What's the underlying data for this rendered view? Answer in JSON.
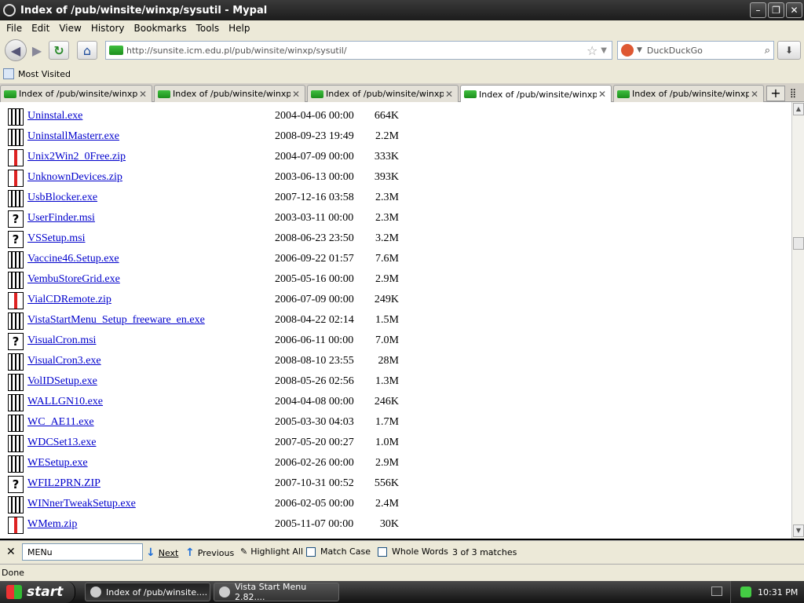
{
  "window": {
    "title": "Index of /pub/winsite/winxp/sysutil - Mypal"
  },
  "menu": [
    "File",
    "Edit",
    "View",
    "History",
    "Bookmarks",
    "Tools",
    "Help"
  ],
  "nav": {
    "url": "http://sunsite.icm.edu.pl/pub/winsite/winxp/sysutil/",
    "search_placeholder": "DuckDuckGo"
  },
  "bookmarks": {
    "most_visited": "Most Visited"
  },
  "tabs": [
    {
      "label": "Index of /pub/winsite/winxp",
      "active": false
    },
    {
      "label": "Index of /pub/winsite/winxp/...",
      "active": false
    },
    {
      "label": "Index of /pub/winsite/winxp/...",
      "active": false
    },
    {
      "label": "Index of /pub/winsite/winxp/...",
      "active": true
    },
    {
      "label": "Index of /pub/winsite/winxp/...",
      "active": false
    }
  ],
  "files": [
    {
      "name": "Uninstal.exe",
      "date": "2004-04-06 00:00",
      "size": "664K",
      "icon": "exe"
    },
    {
      "name": "UninstallMasterr.exe",
      "date": "2008-09-23 19:49",
      "size": "2.2M",
      "icon": "exe"
    },
    {
      "name": "Unix2Win2_0Free.zip",
      "date": "2004-07-09 00:00",
      "size": "333K",
      "icon": "zip"
    },
    {
      "name": "UnknownDevices.zip",
      "date": "2003-06-13 00:00",
      "size": "393K",
      "icon": "zip"
    },
    {
      "name": "UsbBlocker.exe",
      "date": "2007-12-16 03:58",
      "size": "2.3M",
      "icon": "exe"
    },
    {
      "name": "UserFinder.msi",
      "date": "2003-03-11 00:00",
      "size": "2.3M",
      "icon": "unknown"
    },
    {
      "name": "VSSetup.msi",
      "date": "2008-06-23 23:50",
      "size": "3.2M",
      "icon": "unknown"
    },
    {
      "name": "Vaccine46.Setup.exe",
      "date": "2006-09-22 01:57",
      "size": "7.6M",
      "icon": "exe"
    },
    {
      "name": "VembuStoreGrid.exe",
      "date": "2005-05-16 00:00",
      "size": "2.9M",
      "icon": "exe"
    },
    {
      "name": "VialCDRemote.zip",
      "date": "2006-07-09 00:00",
      "size": "249K",
      "icon": "zip"
    },
    {
      "name": "VistaStartMenu_Setup_freeware_en.exe",
      "date": "2008-04-22 02:14",
      "size": "1.5M",
      "icon": "exe"
    },
    {
      "name": "VisualCron.msi",
      "date": "2006-06-11 00:00",
      "size": "7.0M",
      "icon": "unknown"
    },
    {
      "name": "VisualCron3.exe",
      "date": "2008-08-10 23:55",
      "size": "28M",
      "icon": "exe"
    },
    {
      "name": "VolIDSetup.exe",
      "date": "2008-05-26 02:56",
      "size": "1.3M",
      "icon": "exe"
    },
    {
      "name": "WALLGN10.exe",
      "date": "2004-04-08 00:00",
      "size": "246K",
      "icon": "exe"
    },
    {
      "name": "WC_AE11.exe",
      "date": "2005-03-30 04:03",
      "size": "1.7M",
      "icon": "exe"
    },
    {
      "name": "WDCSet13.exe",
      "date": "2007-05-20 00:27",
      "size": "1.0M",
      "icon": "exe"
    },
    {
      "name": "WESetup.exe",
      "date": "2006-02-26 00:00",
      "size": "2.9M",
      "icon": "exe"
    },
    {
      "name": "WFIL2PRN.ZIP",
      "date": "2007-10-31 00:52",
      "size": "556K",
      "icon": "unknown"
    },
    {
      "name": "WINnerTweakSetup.exe",
      "date": "2006-02-05 00:00",
      "size": "2.4M",
      "icon": "exe"
    },
    {
      "name": "WMem.zip",
      "date": "2005-11-07 00:00",
      "size": "30K",
      "icon": "zip"
    }
  ],
  "findbar": {
    "query": "MENu",
    "next": "Next",
    "previous": "Previous",
    "highlight_all": "Highlight All",
    "match_case": "Match Case",
    "whole_words": "Whole Words",
    "status": "3 of 3 matches"
  },
  "status": "Done",
  "taskbar": {
    "start": "start",
    "items": [
      {
        "label": "Index of /pub/winsite....",
        "active": true
      },
      {
        "label": "Vista Start Menu 2.82....",
        "active": false
      }
    ],
    "clock": "10:31 PM"
  }
}
